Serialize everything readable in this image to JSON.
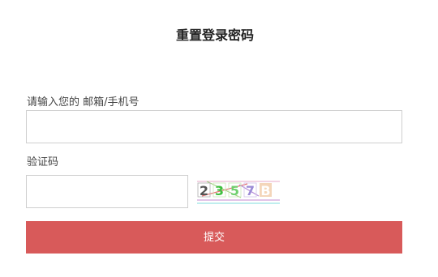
{
  "page": {
    "title": "重置登录密码"
  },
  "form": {
    "account_label": "请输入您的 邮箱/手机号",
    "account_value": "",
    "captcha_label": "验证码",
    "captcha_value": "",
    "captcha_chars": [
      "2",
      "3",
      "5",
      "7",
      "B"
    ],
    "submit_label": "提交"
  }
}
